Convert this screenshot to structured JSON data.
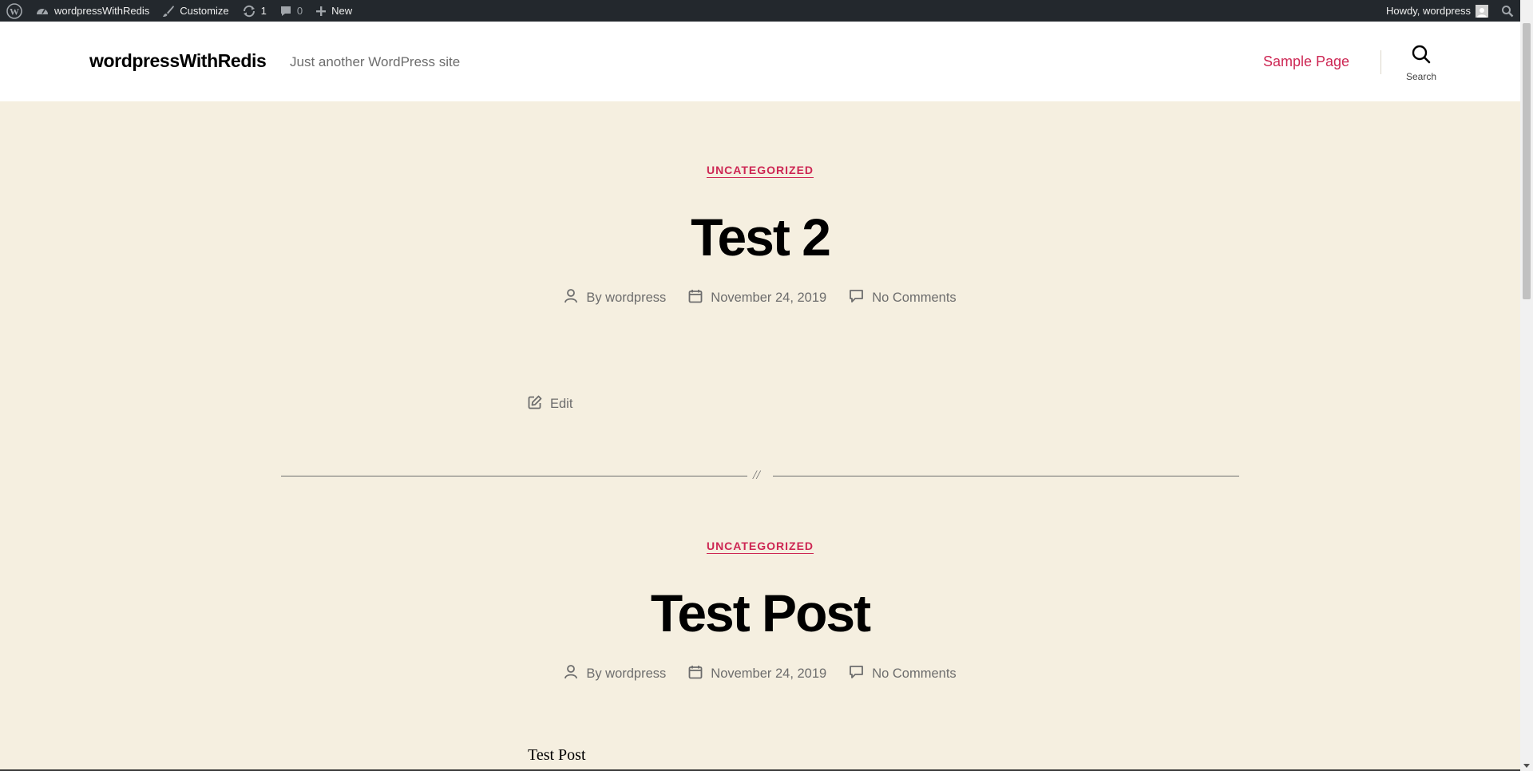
{
  "admin_bar": {
    "site_name": "wordpressWithRedis",
    "customize": "Customize",
    "updates_count": "1",
    "comments_count": "0",
    "new_label": "New",
    "howdy": "Howdy, wordpress"
  },
  "header": {
    "site_title": "wordpressWithRedis",
    "site_description": "Just another WordPress site",
    "nav_items": [
      "Sample Page"
    ],
    "search_label": "Search"
  },
  "posts": [
    {
      "category": "UNCATEGORIZED",
      "title": "Test 2",
      "author": "By wordpress",
      "date": "November 24, 2019",
      "comments": "No Comments",
      "edit_label": "Edit"
    },
    {
      "category": "UNCATEGORIZED",
      "title": "Test Post",
      "author": "By wordpress",
      "date": "November 24, 2019",
      "comments": "No Comments",
      "excerpt": "Test Post"
    }
  ],
  "separator_symbol": "//",
  "colors": {
    "accent": "#cd2653",
    "background": "#f5efe0",
    "admin_bar": "#23282d"
  }
}
